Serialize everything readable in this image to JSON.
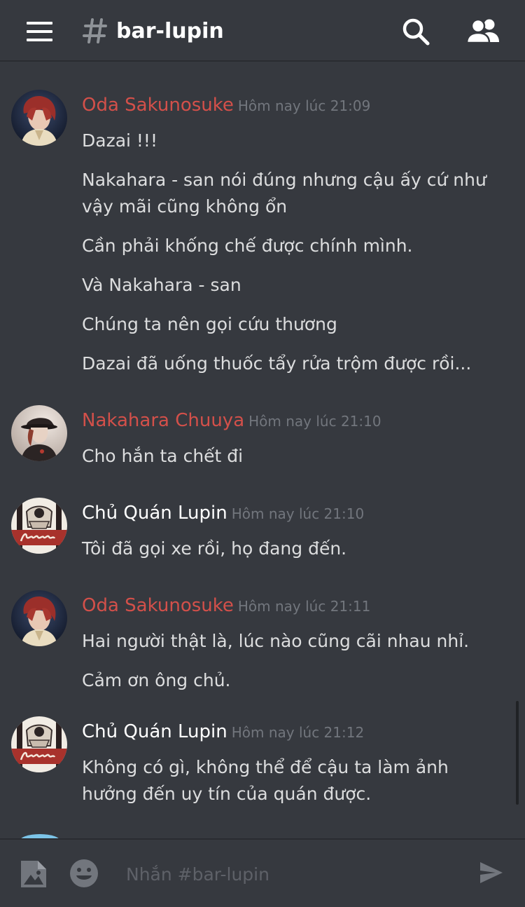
{
  "header": {
    "channel_name": "bar-lupin",
    "colors": {
      "background": "#36393f",
      "title": "#ffffff"
    }
  },
  "messages": [
    {
      "author": "Oda Sakunosuke",
      "author_color": "#d3504a",
      "timestamp": "Hôm nay lúc 21:09",
      "avatar": "oda-avatar",
      "lines": [
        "Dazai !!!",
        "Nakahara - san nói đúng nhưng cậu ấy cứ như vậy mãi cũng không ổn",
        "Cần phải khống chế được chính mình.",
        "Và Nakahara - san",
        "Chúng ta nên gọi cứu thương",
        "Dazai đã uống thuốc tẩy rửa trộm được rồi..."
      ]
    },
    {
      "author": "Nakahara Chuuya",
      "author_color": "#d3504a",
      "timestamp": "Hôm nay lúc 21:10",
      "avatar": "chuuya-avatar",
      "lines": [
        "Cho hắn ta chết đi"
      ]
    },
    {
      "author": "Chủ Quán Lupin",
      "author_color": "#ffffff",
      "timestamp": "Hôm nay lúc 21:10",
      "avatar": "lupin-avatar",
      "lines": [
        "Tôi đã gọi xe rồi, họ đang đến."
      ]
    },
    {
      "author": "Oda Sakunosuke",
      "author_color": "#d3504a",
      "timestamp": "Hôm nay lúc 21:11",
      "avatar": "oda-avatar",
      "lines": [
        "Hai người thật là, lúc nào cũng cãi nhau nhỉ.",
        "Cảm ơn ông chủ."
      ]
    },
    {
      "author": "Chủ Quán Lupin",
      "author_color": "#ffffff",
      "timestamp": "Hôm nay lúc 21:12",
      "avatar": "lupin-avatar",
      "lines": [
        "Không có gì, không thể để cậu ta làm ảnh hưởng đến uy tín của quán được."
      ]
    }
  ],
  "composer": {
    "placeholder": "Nhắn #bar-lupin",
    "value": ""
  },
  "icons": {
    "menu": "hamburger-menu-icon",
    "channel": "hash-icon",
    "search": "search-icon",
    "members": "members-icon",
    "image": "image-upload-icon",
    "emoji": "emoji-icon",
    "send": "send-icon"
  }
}
